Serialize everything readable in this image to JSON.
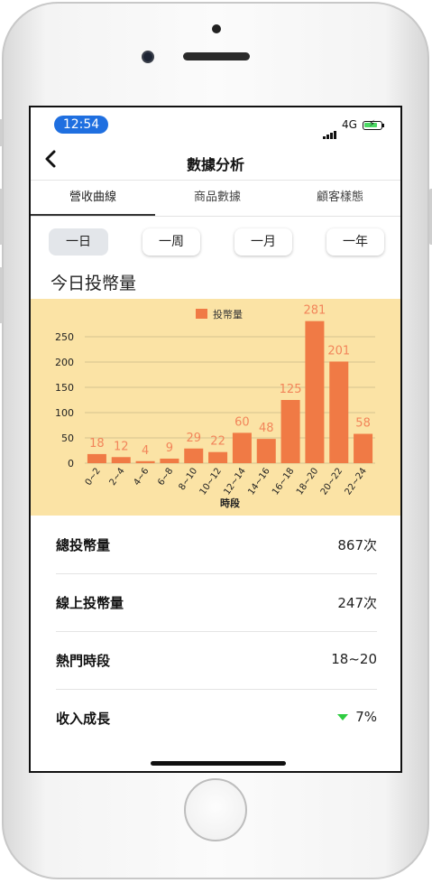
{
  "status_bar": {
    "time": "12:54",
    "network": "4G"
  },
  "nav": {
    "back_icon": "chevron-left-icon",
    "title": "數據分析"
  },
  "tabs": [
    {
      "label": "營收曲線",
      "active": true
    },
    {
      "label": "商品數據",
      "active": false
    },
    {
      "label": "顧客樣態",
      "active": false
    }
  ],
  "ranges": [
    {
      "label": "一日",
      "active": true
    },
    {
      "label": "一周",
      "active": false
    },
    {
      "label": "一月",
      "active": false
    },
    {
      "label": "一年",
      "active": false
    }
  ],
  "section_title": "今日投幣量",
  "chart_data": {
    "type": "bar",
    "legend": "投幣量",
    "legend_position": "top-center",
    "xlabel": "時段",
    "ylabel": "",
    "categories": [
      "0~2",
      "2~4",
      "4~6",
      "6~8",
      "8~10",
      "10~12",
      "12~14",
      "14~16",
      "16~18",
      "18~20",
      "20~22",
      "22~24"
    ],
    "values": [
      18,
      12,
      4,
      9,
      29,
      22,
      60,
      48,
      125,
      281,
      201,
      58
    ],
    "yticks": [
      0,
      50,
      100,
      150,
      200,
      250
    ],
    "ylim": [
      0,
      290
    ],
    "grid": true,
    "bar_color": "#f07a45",
    "label_color": "#f2855a",
    "background": "#fbe3a5"
  },
  "stats": [
    {
      "label": "總投幣量",
      "value": "867次"
    },
    {
      "label": "線上投幣量",
      "value": "247次"
    },
    {
      "label": "熱門時段",
      "value": "18~20"
    },
    {
      "label": "收入成長",
      "value": "7%",
      "trend_icon": "triangle-down-icon",
      "trend_color": "#2ecc40"
    }
  ]
}
